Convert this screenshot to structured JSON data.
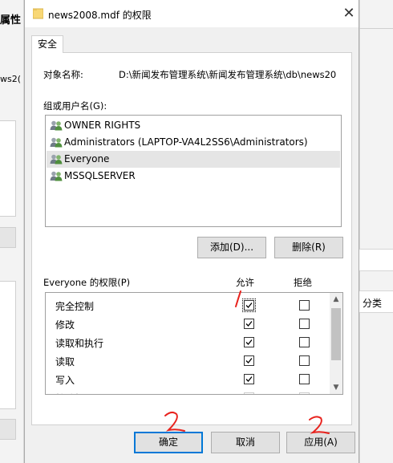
{
  "background": {
    "left_fragments": [
      "属性",
      "ws2("
    ],
    "right_fragment": "分类"
  },
  "dialog": {
    "title": "news2008.mdf 的权限",
    "close_icon": "close-icon",
    "tab_label": "安全",
    "object_name_label": "对象名称:",
    "object_name_value": "D:\\新闻发布管理系统\\新闻发布管理系统\\db\\news20",
    "group_label": "组或用户名(G):",
    "users": [
      {
        "name": "OWNER RIGHTS",
        "selected": false
      },
      {
        "name": "Administrators (LAPTOP-VA4L2SS6\\Administrators)",
        "selected": false
      },
      {
        "name": "Everyone",
        "selected": true
      },
      {
        "name": "MSSQLSERVER",
        "selected": false
      }
    ],
    "add_button": "添加(D)...",
    "remove_button": "删除(R)",
    "perm_label": "Everyone 的权限(P)",
    "allow_header": "允许",
    "deny_header": "拒绝",
    "permissions": [
      {
        "name": "完全控制",
        "allow": true,
        "deny": false
      },
      {
        "name": "修改",
        "allow": true,
        "deny": false
      },
      {
        "name": "读取和执行",
        "allow": true,
        "deny": false
      },
      {
        "name": "读取",
        "allow": true,
        "deny": false
      },
      {
        "name": "写入",
        "allow": true,
        "deny": false
      },
      {
        "name": "特殊权限",
        "allow": false,
        "deny": false
      }
    ],
    "ok_button": "确定",
    "cancel_button": "取消",
    "apply_button": "应用(A)"
  },
  "annotations": [
    "1",
    "2",
    "2"
  ],
  "colors": {
    "annotation": "#e8231e",
    "accent": "#0078d7",
    "folder": "#f8d775"
  }
}
